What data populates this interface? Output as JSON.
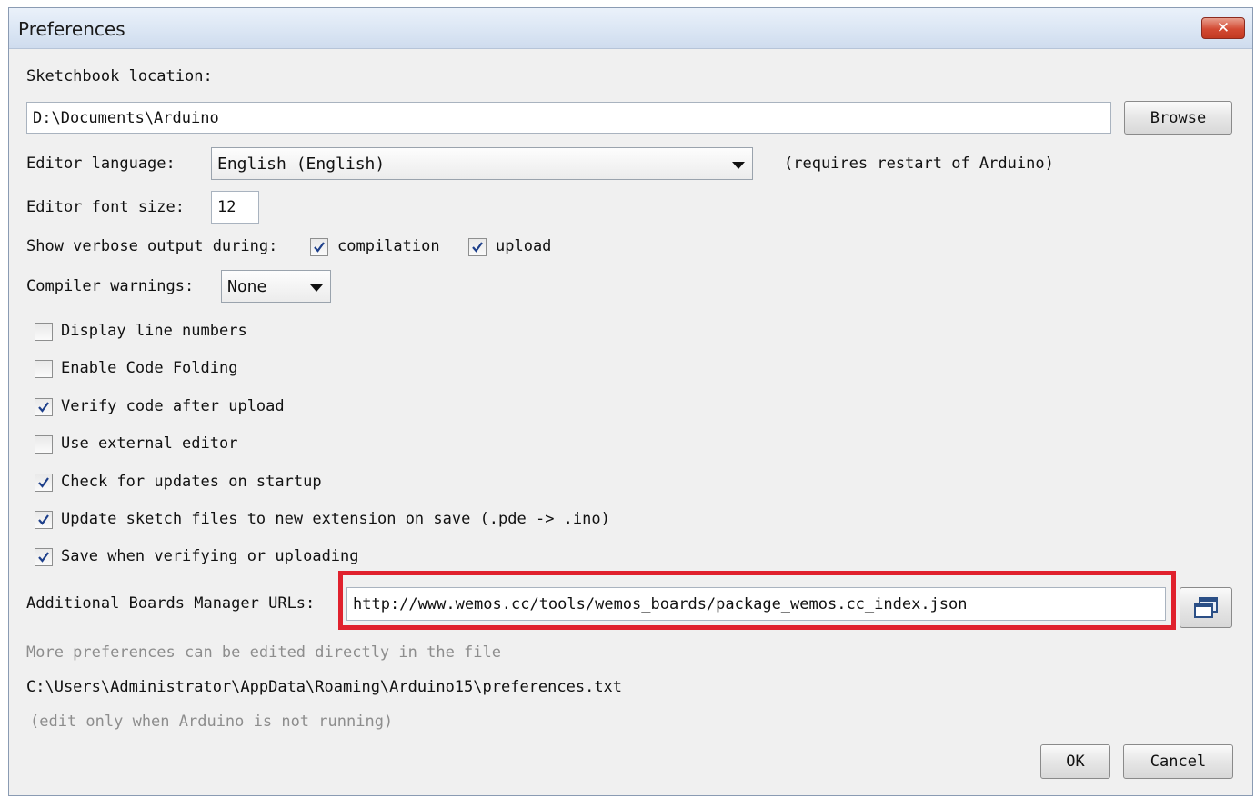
{
  "window": {
    "title": "Preferences",
    "close_label": "✕"
  },
  "sketchbook": {
    "label": "Sketchbook location:",
    "value": "D:\\Documents\\Arduino",
    "browse_label": "Browse"
  },
  "language": {
    "label": "Editor language:",
    "value": "English (English)",
    "note": "(requires restart of Arduino)"
  },
  "font_size": {
    "label": "Editor font size:",
    "value": "12"
  },
  "verbose": {
    "label": "Show verbose output during:",
    "compilation_label": "compilation",
    "compilation_checked": true,
    "upload_label": "upload",
    "upload_checked": true
  },
  "warnings": {
    "label": "Compiler warnings:",
    "value": "None"
  },
  "options": [
    {
      "label": "Display line numbers",
      "checked": false
    },
    {
      "label": "Enable Code Folding",
      "checked": false
    },
    {
      "label": "Verify code after upload",
      "checked": true
    },
    {
      "label": "Use external editor",
      "checked": false
    },
    {
      "label": "Check for updates on startup",
      "checked": true
    },
    {
      "label": "Update sketch files to new extension on save (.pde -> .ino)",
      "checked": true
    },
    {
      "label": "Save when verifying or uploading",
      "checked": true
    }
  ],
  "boards": {
    "label": "Additional Boards Manager URLs:",
    "value": "http://www.wemos.cc/tools/wemos_boards/package_wemos.cc_index.json",
    "highlight_color": "#e0212d"
  },
  "footer": {
    "more_text": "More preferences can be edited directly in the file",
    "path": "C:\\Users\\Administrator\\AppData\\Roaming\\Arduino15\\preferences.txt",
    "note": "(edit only when Arduino is not running)"
  },
  "buttons": {
    "ok_label": "OK",
    "cancel_label": "Cancel"
  },
  "icons": {
    "checkmark": "check-icon",
    "dropdown": "chevron-down-icon",
    "window_edit": "expand-window-icon"
  }
}
